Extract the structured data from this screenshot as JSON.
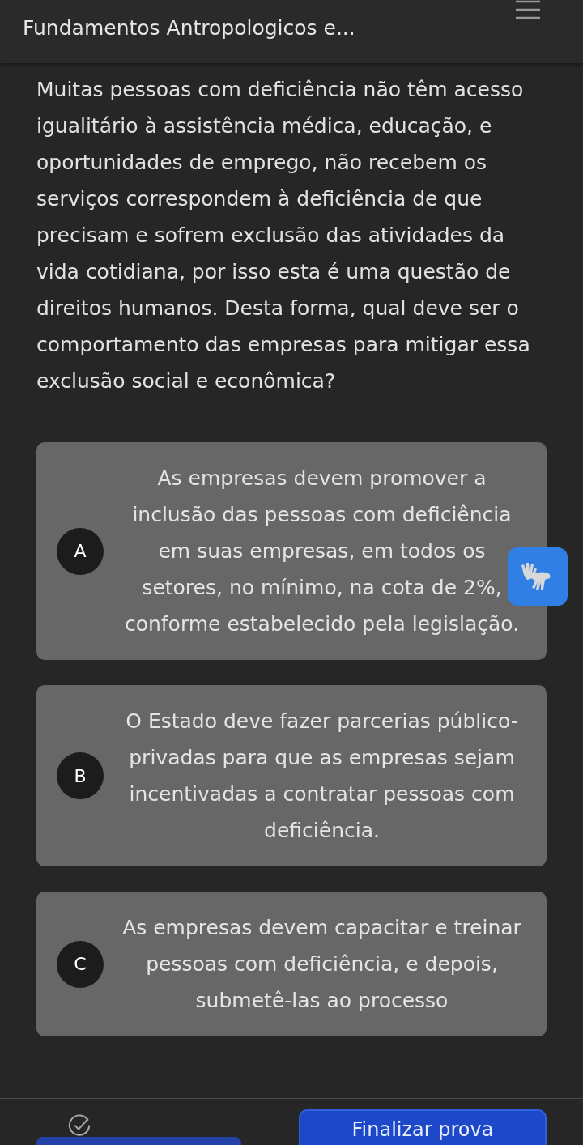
{
  "header": {
    "title": "Fundamentos Antropologicos e..."
  },
  "question": {
    "text": "Muitas pessoas com deficiência não têm acesso igualitário à assistência médica, educação, e oportunidades de emprego, não recebem os serviços correspondem à deficiência de que precisam e sofrem exclusão das atividades da vida cotidiana, por isso esta é uma questão de direitos humanos. Desta forma, qual deve ser o comportamento das empresas para mitigar essa exclusão social e econômica?"
  },
  "options": [
    {
      "letter": "A",
      "text": "As empresas devem promover a inclusão das pessoas com deficiência em suas empresas, em todos os setores, no mínimo, na cota de 2%, conforme estabelecido pela legislação."
    },
    {
      "letter": "B",
      "text": "O Estado deve fazer parcerias público-privadas para que as empresas sejam incentivadas a contratar pessoas com deficiência."
    },
    {
      "letter": "C",
      "text": "As empresas devem capacitar e treinar pessoas com deficiência, e depois, submetê-las ao processo"
    }
  ],
  "footer": {
    "finish_button": "Finalizar prova"
  }
}
